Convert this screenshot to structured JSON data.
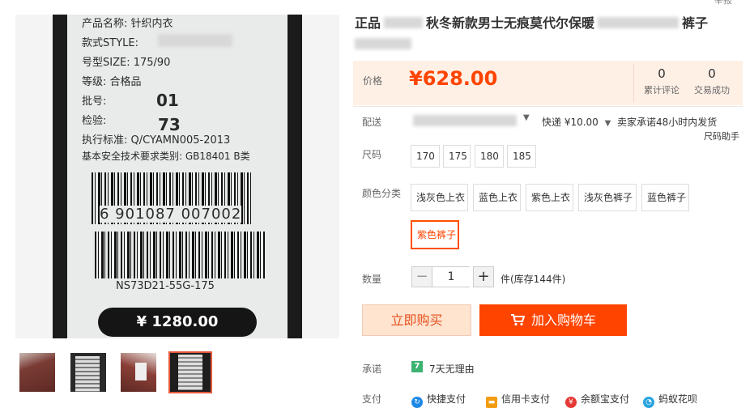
{
  "top_note": "举报",
  "title": {
    "prefix": "正品",
    "main": "秋冬新款男士无痕莫代尔保暖",
    "suffix": "裤子"
  },
  "tag": {
    "lines": [
      "产品名称: 针织内衣",
      "款式STYLE:",
      "号型SIZE: 175/90",
      "等级: 合格品",
      "批号:",
      "检验:",
      "执行标准: Q/CYAMN005-2013",
      "基本安全技术要求类别: GB18401 B类"
    ],
    "batch": "01",
    "check": "73",
    "barcode_number": "6 901087 007002",
    "code": "NS73D21-55G-175",
    "price": "¥ 1280.00"
  },
  "price_section": {
    "label": "价格",
    "price": "¥628.00",
    "reviews": {
      "count": "0",
      "label": "累计评论"
    },
    "sales": {
      "count": "0",
      "label": "交易成功"
    }
  },
  "delivery": {
    "label": "配送",
    "method": "快递 ¥10.00",
    "promise": "卖家承诺48小时内发货",
    "size_helper": "尺码助手"
  },
  "size": {
    "label": "尺码",
    "options": [
      "170",
      "175",
      "180",
      "185"
    ]
  },
  "color": {
    "label": "颜色分类",
    "options": [
      "浅灰色上衣",
      "蓝色上衣",
      "紫色上衣",
      "浅灰色裤子",
      "蓝色裤子",
      "紫色裤子"
    ],
    "selected": "紫色裤子"
  },
  "quantity": {
    "label": "数量",
    "value": "1",
    "minus": "−",
    "plus": "+",
    "stock": "件(库存144件)"
  },
  "buttons": {
    "buy": "立即购买",
    "cart": "加入购物车"
  },
  "promise": {
    "label": "承诺",
    "text": "7天无理由",
    "badge": "7"
  },
  "payment": {
    "label": "支付",
    "methods": [
      "快捷支付",
      "信用卡支付",
      "余额宝支付",
      "蚂蚁花呗"
    ]
  },
  "colors": {
    "accent": "#ff4400",
    "price_bg": "#fff0e6",
    "buy_bg": "#ffe4d0"
  }
}
